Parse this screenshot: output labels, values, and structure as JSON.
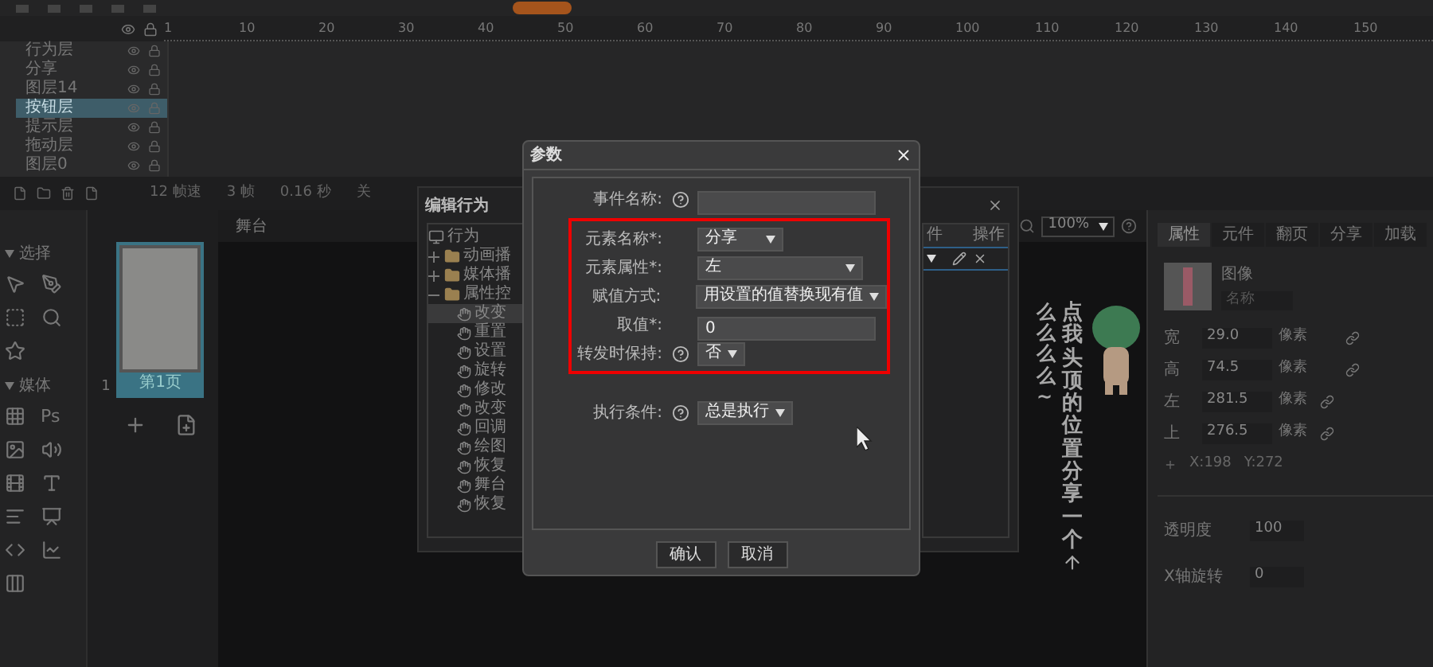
{
  "ruler": {
    "ticks": [
      "1",
      "10",
      "20",
      "30",
      "40",
      "50",
      "60",
      "70",
      "80",
      "90",
      "100",
      "110",
      "120",
      "130",
      "140",
      "150"
    ]
  },
  "layers": [
    {
      "name": "行为层",
      "selected": false
    },
    {
      "name": "分享",
      "selected": false
    },
    {
      "name": "图层14",
      "selected": false
    },
    {
      "name": "按钮层",
      "selected": true
    },
    {
      "name": "提示层",
      "selected": false
    },
    {
      "name": "拖动层",
      "selected": false
    },
    {
      "name": "图层0",
      "selected": false
    }
  ],
  "timeline_status": [
    "12 帧速",
    "3 帧",
    "0.16 秒",
    "关"
  ],
  "tool_sections": [
    {
      "title": "选择",
      "expanded": true
    },
    {
      "title": "媒体",
      "expanded": true,
      "text_tool": "Ps"
    }
  ],
  "pages": [
    {
      "number": "1",
      "label": "第1页",
      "selected": true
    }
  ],
  "stage": {
    "tab": "舞台",
    "zoom": "100%",
    "texts": [
      "么么么么~",
      "点我头顶的位置分享一个"
    ]
  },
  "behavior_window": {
    "title": "编辑行为",
    "root": "行为",
    "groups": [
      {
        "label": "动画播",
        "expanded": false
      },
      {
        "label": "媒体播",
        "expanded": false
      },
      {
        "label": "属性控",
        "expanded": true,
        "children": [
          {
            "label": "改变",
            "selected": true
          },
          {
            "label": "重置",
            "selected": false
          },
          {
            "label": "设置",
            "selected": false
          },
          {
            "label": "旋转",
            "selected": false
          },
          {
            "label": "修改",
            "selected": false
          },
          {
            "label": "改变",
            "selected": false
          },
          {
            "label": "回调",
            "selected": false
          },
          {
            "label": "绘图",
            "selected": false
          },
          {
            "label": "恢复",
            "selected": false
          },
          {
            "label": "舞台",
            "selected": false
          },
          {
            "label": "恢复",
            "selected": false
          }
        ]
      }
    ],
    "columns": [
      "件",
      "操作"
    ]
  },
  "dialog": {
    "title": "参数",
    "fields": [
      {
        "label": "事件名称:",
        "help": true,
        "kind": "input",
        "highlighted": false
      },
      {
        "label": "元素名称*:",
        "help": false,
        "kind": "select",
        "value": "分享",
        "highlighted": true
      },
      {
        "label": "元素属性*:",
        "help": false,
        "kind": "select",
        "value": "左",
        "highlighted": true
      },
      {
        "label": "赋值方式:",
        "help": false,
        "kind": "select",
        "value": "用设置的值替换现有值",
        "highlighted": true
      },
      {
        "label": "取值*:",
        "help": false,
        "kind": "input",
        "value": "0",
        "highlighted": true
      },
      {
        "label": "转发时保持:",
        "help": true,
        "kind": "select",
        "value": "否",
        "highlighted": true
      },
      {
        "label": "执行条件:",
        "help": true,
        "kind": "select",
        "value": "总是执行",
        "highlighted": false
      }
    ],
    "buttons": [
      "确认",
      "取消"
    ]
  },
  "properties": {
    "tabs": [
      {
        "label": "属性",
        "selected": true
      },
      {
        "label": "元件",
        "selected": false
      },
      {
        "label": "翻页",
        "selected": false
      },
      {
        "label": "分享",
        "selected": false
      },
      {
        "label": "加载",
        "selected": false
      }
    ],
    "object_type": "图像",
    "name_placeholder": "名称",
    "rows": [
      {
        "label": "宽",
        "value": "29.0",
        "unit": "像素"
      },
      {
        "label": "高",
        "value": "74.5",
        "unit": "像素"
      },
      {
        "label": "左",
        "value": "281.5",
        "unit": "像素"
      },
      {
        "label": "上",
        "value": "276.5",
        "unit": "像素"
      }
    ],
    "coords": [
      "X:198",
      "Y:272"
    ],
    "extra_rows": [
      {
        "label": "透明度",
        "value": "100"
      },
      {
        "label": "X轴旋转",
        "value": "0"
      }
    ]
  }
}
